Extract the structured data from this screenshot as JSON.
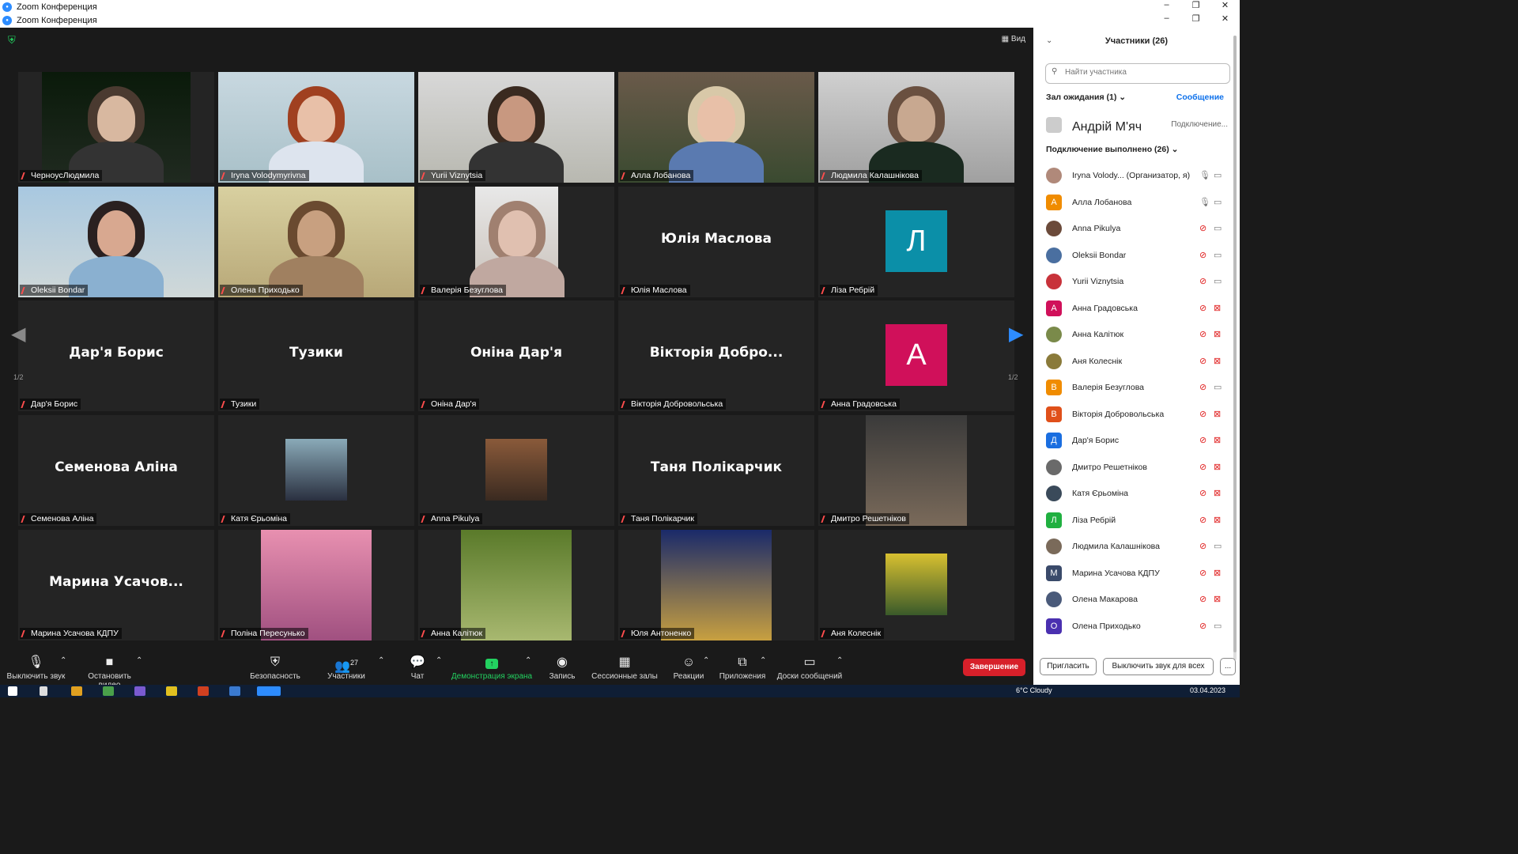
{
  "window": {
    "title1": "Zoom Конференция",
    "title2": "Zoom Конференция",
    "view_label": "Вид"
  },
  "tiles": [
    {
      "caption": "ЧерноусЛюдмила",
      "big": "",
      "type": "photo"
    },
    {
      "caption": "Iryna Volodymyrivna",
      "big": "",
      "type": "photo"
    },
    {
      "caption": "Yurii Viznytsia",
      "big": "",
      "type": "photo"
    },
    {
      "caption": "Алла Лобанова",
      "big": "",
      "type": "photo"
    },
    {
      "caption": "Людмила Калашнікова",
      "big": "",
      "type": "photo"
    },
    {
      "caption": "Oleksii Bondar",
      "big": "",
      "type": "photo"
    },
    {
      "caption": "Олена Приходько",
      "big": "",
      "type": "photo"
    },
    {
      "caption": "Валерія Безуглова",
      "big": "",
      "type": "photo"
    },
    {
      "caption": "Юлія Маслова",
      "big": "Юлія Маслова",
      "type": "name"
    },
    {
      "caption": "Ліза Ребрій",
      "big": "Л",
      "type": "avatar"
    },
    {
      "caption": "Дар'я Борис",
      "big": "Дар'я Борис",
      "type": "name"
    },
    {
      "caption": "Тузики",
      "big": "Тузики",
      "type": "name"
    },
    {
      "caption": "Оніна Дар'я",
      "big": "Оніна Дар'я",
      "type": "name"
    },
    {
      "caption": "Вікторія Добровольська",
      "big": "Вікторія Добро...",
      "type": "name"
    },
    {
      "caption": "Анна Градовська",
      "big": "А",
      "type": "avatar"
    },
    {
      "caption": "Семенова Аліна",
      "big": "Семенова Аліна",
      "type": "name"
    },
    {
      "caption": "Катя Єрьоміна",
      "big": "",
      "type": "photo"
    },
    {
      "caption": "Anna Pikulya",
      "big": "",
      "type": "photo"
    },
    {
      "caption": "Таня Полікарчик",
      "big": "Таня Полікарчик",
      "type": "name"
    },
    {
      "caption": "Дмитро Решетніков",
      "big": "",
      "type": "photo"
    },
    {
      "caption": "Марина Усачова КДПУ",
      "big": "Марина Усачов...",
      "type": "name"
    },
    {
      "caption": "Поліна Пересунько",
      "big": "",
      "type": "photo"
    },
    {
      "caption": "Анна Калітюк",
      "big": "",
      "type": "photo"
    },
    {
      "caption": "Юля Антоненко",
      "big": "",
      "type": "photo"
    },
    {
      "caption": "Аня Колеснік",
      "big": "",
      "type": "photo"
    }
  ],
  "pagination": {
    "left": "1/2",
    "right": "1/2"
  },
  "toolbar": {
    "mute": "Выключить звук",
    "video": "Остановить видео",
    "security": "Безопасность",
    "participants": "Участники",
    "participants_count": "27",
    "chat": "Чат",
    "share": "Демонстрация экрана",
    "record": "Запись",
    "breakout": "Сессионные залы",
    "reactions": "Реакции",
    "apps": "Приложения",
    "whiteboard": "Доски сообщений",
    "end": "Завершение"
  },
  "panel": {
    "title": "Участники (26)",
    "search_placeholder": "Найти участника",
    "waiting_header": "Зал ожидания (1)",
    "message_link": "Сообщение",
    "waiting_name": "Андрій М'яч",
    "waiting_status": "Подключение...",
    "connected_header": "Подключение выполнено (26)",
    "invite": "Пригласить",
    "mute_all": "Выключить звук для всех",
    "more": "..."
  },
  "participants": [
    {
      "name": "Iryna Volody...   (Организатор, я)",
      "initial": "",
      "color": "#b0897a",
      "mic": "on",
      "cam": "on"
    },
    {
      "name": "Алла Лобанова",
      "initial": "А",
      "color": "#f08c00",
      "mic": "on",
      "cam": "on"
    },
    {
      "name": "Anna Pikulya",
      "initial": "",
      "color": "#6b4a3a",
      "mic": "off",
      "cam": "on"
    },
    {
      "name": "Oleksii Bondar",
      "initial": "",
      "color": "#4a6fa0",
      "mic": "off",
      "cam": "on"
    },
    {
      "name": "Yurii Viznytsia",
      "initial": "",
      "color": "#c8323a",
      "mic": "off",
      "cam": "on"
    },
    {
      "name": "Анна Градовська",
      "initial": "А",
      "color": "#d0105a",
      "mic": "off",
      "cam": "off"
    },
    {
      "name": "Анна Калітюк",
      "initial": "",
      "color": "#7a8a4a",
      "mic": "off",
      "cam": "off"
    },
    {
      "name": "Аня Колеснік",
      "initial": "",
      "color": "#8a7a3a",
      "mic": "off",
      "cam": "off"
    },
    {
      "name": "Валерія Безуглова",
      "initial": "В",
      "color": "#f08c00",
      "mic": "off",
      "cam": "on"
    },
    {
      "name": "Вікторія Добровольська",
      "initial": "В",
      "color": "#e0501a",
      "mic": "off",
      "cam": "off"
    },
    {
      "name": "Дар'я Борис",
      "initial": "Д",
      "color": "#1a6ee0",
      "mic": "off",
      "cam": "off"
    },
    {
      "name": "Дмитро Решетніков",
      "initial": "",
      "color": "#6a6a6a",
      "mic": "off",
      "cam": "off"
    },
    {
      "name": "Катя Єрьоміна",
      "initial": "",
      "color": "#3a4a5a",
      "mic": "off",
      "cam": "off"
    },
    {
      "name": "Ліза Ребрій",
      "initial": "Л",
      "color": "#20b040",
      "mic": "off",
      "cam": "off"
    },
    {
      "name": "Людмила Калашнікова",
      "initial": "",
      "color": "#7a6a5a",
      "mic": "off",
      "cam": "on"
    },
    {
      "name": "Марина Усачова КДПУ",
      "initial": "М",
      "color": "#3a4a6a",
      "mic": "off",
      "cam": "off"
    },
    {
      "name": "Олена Макарова",
      "initial": "",
      "color": "#4a5a7a",
      "mic": "off",
      "cam": "off"
    },
    {
      "name": "Олена Приходько",
      "initial": "О",
      "color": "#4a30b0",
      "mic": "off",
      "cam": "on"
    }
  ],
  "taskbar": {
    "weather": "6°C Cloudy",
    "date": "03.04.2023"
  },
  "colors": {
    "accent": "#2d8cff",
    "active_border": "#d7e35a",
    "end_red": "#d7202a",
    "share_green": "#23d160",
    "muted_red": "#e02020",
    "avatar_teal": "#0b8fa8",
    "avatar_pink": "#d0105a"
  }
}
